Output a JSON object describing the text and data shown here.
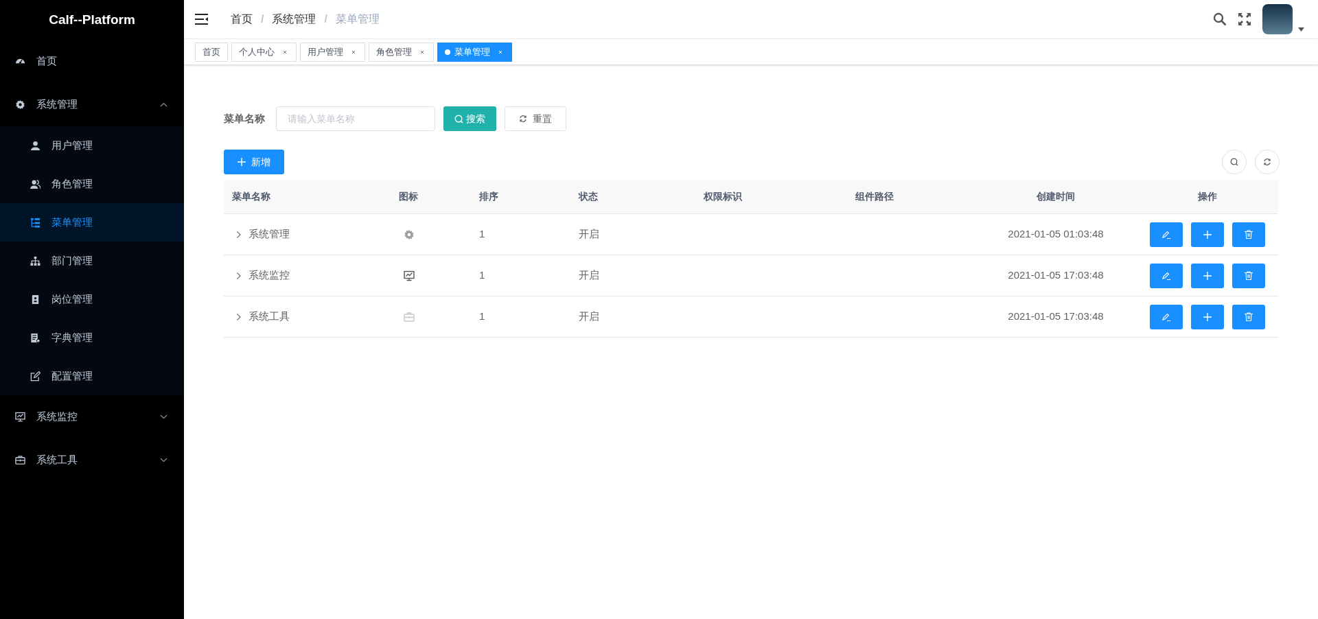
{
  "sidebar": {
    "title": "Calf--Platform",
    "items": [
      {
        "label": "首页",
        "kind": "dashboard",
        "selected": false
      },
      {
        "label": "系统管理",
        "kind": "gear",
        "expanded": true,
        "selected": false,
        "children": [
          {
            "label": "用户管理",
            "kind": "user",
            "selected": false
          },
          {
            "label": "角色管理",
            "kind": "users",
            "selected": false
          },
          {
            "label": "菜单管理",
            "kind": "tree",
            "selected": true
          },
          {
            "label": "部门管理",
            "kind": "org",
            "selected": false
          },
          {
            "label": "岗位管理",
            "kind": "badge",
            "selected": false
          },
          {
            "label": "字典管理",
            "kind": "dict",
            "selected": false
          },
          {
            "label": "配置管理",
            "kind": "edit",
            "selected": false
          }
        ]
      },
      {
        "label": "系统监控",
        "kind": "monitor",
        "expanded": false,
        "selected": false
      },
      {
        "label": "系统工具",
        "kind": "toolbox",
        "expanded": false,
        "selected": false
      }
    ]
  },
  "breadcrumb": [
    {
      "text": "首页",
      "kind": "link"
    },
    {
      "text": "/",
      "kind": "separator"
    },
    {
      "text": "系统管理",
      "kind": "link"
    },
    {
      "text": "/",
      "kind": "separator"
    },
    {
      "text": "菜单管理",
      "kind": "current"
    }
  ],
  "tags": [
    {
      "label": "首页",
      "closable": false,
      "selected": false
    },
    {
      "label": "个人中心",
      "closable": true,
      "selected": false
    },
    {
      "label": "用户管理",
      "closable": true,
      "selected": false
    },
    {
      "label": "角色管理",
      "closable": true,
      "selected": false
    },
    {
      "label": "菜单管理",
      "closable": true,
      "selected": true
    }
  ],
  "search": {
    "label": "菜单名称",
    "placeholder": "请输入菜单名称",
    "search_button": "搜索",
    "reset_button": "重置"
  },
  "add_button": "新增",
  "table": {
    "columns": [
      "菜单名称",
      "图标",
      "排序",
      "状态",
      "权限标识",
      "组件路径",
      "创建时间",
      "操作"
    ],
    "rows": [
      {
        "name": "系统管理",
        "kind": "gear",
        "order": "1",
        "status": "开启",
        "created": "2021-01-05 01:03:48"
      },
      {
        "name": "系统监控",
        "kind": "monitor",
        "order": "1",
        "status": "开启",
        "created": "2021-01-05 17:03:48"
      },
      {
        "name": "系统工具",
        "kind": "toolbox",
        "order": "1",
        "status": "开启",
        "created": "2021-01-05 17:03:48"
      }
    ]
  }
}
